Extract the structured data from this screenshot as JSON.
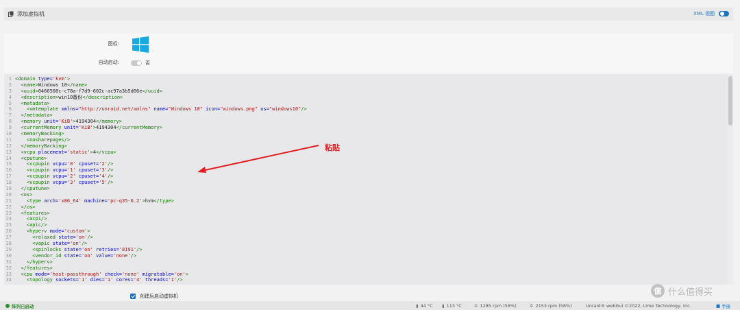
{
  "header": {
    "title": "添加虚拟机",
    "xml_view_label": "XML 视图"
  },
  "form": {
    "icon_label": "图标:",
    "autostart_label": "自动启动:",
    "autostart_value": "否"
  },
  "editor": {
    "lines": [
      {
        "n": "1",
        "parts": [
          [
            "tag",
            "<domain "
          ],
          [
            "attr",
            "type="
          ],
          [
            "str",
            "'kvm'"
          ],
          [
            "tag",
            ">"
          ]
        ]
      },
      {
        "n": "2",
        "parts": [
          [
            "tag",
            "  <name>"
          ],
          [
            "txt",
            "Windows 10"
          ],
          [
            "tag",
            "</name>"
          ]
        ]
      },
      {
        "n": "3",
        "parts": [
          [
            "tag",
            "  <uuid>"
          ],
          [
            "txt",
            "0466508c-c78a-f7d9-602c-ac97a3b5d06e"
          ],
          [
            "tag",
            "</uuid>"
          ]
        ]
      },
      {
        "n": "4",
        "parts": [
          [
            "tag",
            "  <description>"
          ],
          [
            "txt",
            "win10备份"
          ],
          [
            "tag",
            "</description>"
          ]
        ]
      },
      {
        "n": "5",
        "parts": [
          [
            "tag",
            "  <metadata>"
          ]
        ]
      },
      {
        "n": "6",
        "parts": [
          [
            "tag",
            "    <vmtemplate "
          ],
          [
            "attr",
            "xmlns="
          ],
          [
            "str",
            "\"http://unraid.net/xmlns\""
          ],
          [
            "attr",
            " name="
          ],
          [
            "str",
            "\"Windows 10\""
          ],
          [
            "attr",
            " icon="
          ],
          [
            "str",
            "\"windows.png\""
          ],
          [
            "attr",
            " os="
          ],
          [
            "str",
            "\"windows10\""
          ],
          [
            "tag",
            "/>"
          ]
        ]
      },
      {
        "n": "7",
        "parts": [
          [
            "tag",
            "  </metadata>"
          ]
        ]
      },
      {
        "n": "8",
        "parts": [
          [
            "tag",
            "  <memory "
          ],
          [
            "attr",
            "unit="
          ],
          [
            "str",
            "'KiB'"
          ],
          [
            "tag",
            ">"
          ],
          [
            "txt",
            "4194304"
          ],
          [
            "tag",
            "</memory>"
          ]
        ]
      },
      {
        "n": "9",
        "parts": [
          [
            "tag",
            "  <currentMemory "
          ],
          [
            "attr",
            "unit="
          ],
          [
            "str",
            "'KiB'"
          ],
          [
            "tag",
            ">"
          ],
          [
            "txt",
            "4194304"
          ],
          [
            "tag",
            "</currentMemory>"
          ]
        ]
      },
      {
        "n": "10",
        "parts": [
          [
            "tag",
            "  <memoryBacking>"
          ]
        ]
      },
      {
        "n": "11",
        "parts": [
          [
            "tag",
            "    <nosharepages/>"
          ]
        ]
      },
      {
        "n": "12",
        "parts": [
          [
            "tag",
            "  </memoryBacking>"
          ]
        ]
      },
      {
        "n": "13",
        "parts": [
          [
            "tag",
            "  <vcpu "
          ],
          [
            "attr",
            "placement="
          ],
          [
            "str",
            "'static'"
          ],
          [
            "tag",
            ">"
          ],
          [
            "txt",
            "4"
          ],
          [
            "tag",
            "</vcpu>"
          ]
        ]
      },
      {
        "n": "14",
        "parts": [
          [
            "tag",
            "  <cputune>"
          ]
        ]
      },
      {
        "n": "15",
        "parts": [
          [
            "tag",
            "    <vcpupin "
          ],
          [
            "attr",
            "vcpu="
          ],
          [
            "str",
            "'0'"
          ],
          [
            "attr",
            " cpuset="
          ],
          [
            "str",
            "'2'"
          ],
          [
            "tag",
            "/>"
          ]
        ]
      },
      {
        "n": "16",
        "parts": [
          [
            "tag",
            "    <vcpupin "
          ],
          [
            "attr",
            "vcpu="
          ],
          [
            "str",
            "'1'"
          ],
          [
            "attr",
            " cpuset="
          ],
          [
            "str",
            "'3'"
          ],
          [
            "tag",
            "/>"
          ]
        ]
      },
      {
        "n": "17",
        "parts": [
          [
            "tag",
            "    <vcpupin "
          ],
          [
            "attr",
            "vcpu="
          ],
          [
            "str",
            "'2'"
          ],
          [
            "attr",
            " cpuset="
          ],
          [
            "str",
            "'4'"
          ],
          [
            "tag",
            "/>"
          ]
        ]
      },
      {
        "n": "18",
        "parts": [
          [
            "tag",
            "    <vcpupin "
          ],
          [
            "attr",
            "vcpu="
          ],
          [
            "str",
            "'3'"
          ],
          [
            "attr",
            " cpuset="
          ],
          [
            "str",
            "'5'"
          ],
          [
            "tag",
            "/>"
          ]
        ]
      },
      {
        "n": "19",
        "parts": [
          [
            "tag",
            "  </cputune>"
          ]
        ]
      },
      {
        "n": "20",
        "parts": [
          [
            "tag",
            "  <os>"
          ]
        ]
      },
      {
        "n": "21",
        "parts": [
          [
            "tag",
            "    <type "
          ],
          [
            "attr",
            "arch="
          ],
          [
            "str",
            "'x86_64'"
          ],
          [
            "attr",
            " machine="
          ],
          [
            "str",
            "'pc-q35-6.2'"
          ],
          [
            "tag",
            ">"
          ],
          [
            "txt",
            "hvm"
          ],
          [
            "tag",
            "</type>"
          ]
        ]
      },
      {
        "n": "22",
        "parts": [
          [
            "tag",
            "  </os>"
          ]
        ]
      },
      {
        "n": "23",
        "parts": [
          [
            "tag",
            "  <features>"
          ]
        ]
      },
      {
        "n": "24",
        "parts": [
          [
            "tag",
            "    <acpi/>"
          ]
        ]
      },
      {
        "n": "25",
        "parts": [
          [
            "tag",
            "    <apic/>"
          ]
        ]
      },
      {
        "n": "26",
        "parts": [
          [
            "tag",
            "    <hyperv "
          ],
          [
            "attr",
            "mode="
          ],
          [
            "str",
            "'custom'"
          ],
          [
            "tag",
            ">"
          ]
        ]
      },
      {
        "n": "27",
        "parts": [
          [
            "tag",
            "      <relaxed "
          ],
          [
            "attr",
            "state="
          ],
          [
            "str",
            "'on'"
          ],
          [
            "tag",
            "/>"
          ]
        ]
      },
      {
        "n": "28",
        "parts": [
          [
            "tag",
            "      <vapic "
          ],
          [
            "attr",
            "state="
          ],
          [
            "str",
            "'on'"
          ],
          [
            "tag",
            "/>"
          ]
        ]
      },
      {
        "n": "29",
        "parts": [
          [
            "tag",
            "      <spinlocks "
          ],
          [
            "attr",
            "state="
          ],
          [
            "str",
            "'on'"
          ],
          [
            "attr",
            " retries="
          ],
          [
            "str",
            "'8191'"
          ],
          [
            "tag",
            "/>"
          ]
        ]
      },
      {
        "n": "30",
        "parts": [
          [
            "tag",
            "      <vendor_id "
          ],
          [
            "attr",
            "state="
          ],
          [
            "str",
            "'on'"
          ],
          [
            "attr",
            " value="
          ],
          [
            "str",
            "'none'"
          ],
          [
            "tag",
            "/>"
          ]
        ]
      },
      {
        "n": "31",
        "parts": [
          [
            "tag",
            "    </hyperv>"
          ]
        ]
      },
      {
        "n": "32",
        "parts": [
          [
            "tag",
            "  </features>"
          ]
        ]
      },
      {
        "n": "33",
        "parts": [
          [
            "tag",
            "  <cpu "
          ],
          [
            "attr",
            "mode="
          ],
          [
            "str",
            "'host-passthrough'"
          ],
          [
            "attr",
            " check="
          ],
          [
            "str",
            "'none'"
          ],
          [
            "attr",
            " migratable="
          ],
          [
            "str",
            "'on'"
          ],
          [
            "tag",
            ">"
          ]
        ]
      },
      {
        "n": "34",
        "parts": [
          [
            "tag",
            "    <topology "
          ],
          [
            "attr",
            "sockets="
          ],
          [
            "str",
            "'1'"
          ],
          [
            "attr",
            " dies="
          ],
          [
            "str",
            "'1'"
          ],
          [
            "attr",
            " cores="
          ],
          [
            "str",
            "'4'"
          ],
          [
            "attr",
            " threads="
          ],
          [
            "str",
            "'1'"
          ],
          [
            "tag",
            "/>"
          ]
        ]
      }
    ]
  },
  "annotation": {
    "paste_label": "粘贴",
    "arrow_color": "#e02020"
  },
  "footer": {
    "start_after_create_label": "创建后启动虚拟机",
    "array_status": "阵列已启动",
    "temp_cpu": "44 °C",
    "temp_board": "113 °C",
    "fan1": "1285 rpm (58%)",
    "fan2": "2153 rpm (58%)",
    "copyright": "Unraid® webGui ©2022, Lime Technology, Inc.",
    "manual_label": "手册"
  },
  "watermark": {
    "badge": "值",
    "text": "什么值得买"
  },
  "colors": {
    "accent": "#1e73be",
    "windows_logo": "#19a9e1",
    "status_green": "#2b8a2b"
  }
}
